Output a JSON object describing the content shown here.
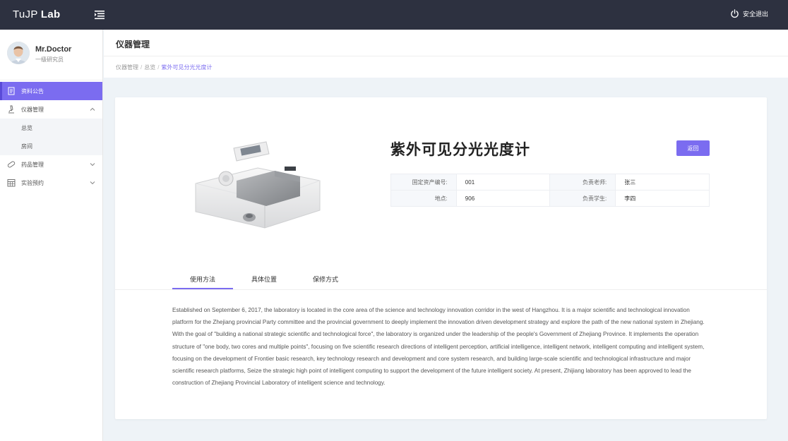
{
  "topbar": {
    "brand_prefix": "TuJP",
    "brand_suffix": "Lab",
    "logout_label": "安全退出"
  },
  "user": {
    "name": "Mr.Doctor",
    "role": "一级研究员"
  },
  "sidebar": {
    "items": [
      {
        "label": "资料公告",
        "icon": "document-icon"
      },
      {
        "label": "仪器管理",
        "icon": "microscope-icon",
        "expanded": true
      },
      {
        "label": "总览"
      },
      {
        "label": "房间"
      },
      {
        "label": "药品管理",
        "icon": "pill-icon"
      },
      {
        "label": "实验预约",
        "icon": "calendar-icon"
      }
    ]
  },
  "page": {
    "title": "仪器管理",
    "breadcrumb": [
      "仪器管理",
      "总览",
      "紫外可见分光光度计"
    ]
  },
  "instrument": {
    "name": "紫外可见分光光度计",
    "back_label": "返回",
    "fields": {
      "asset_no_label": "固定资产编号:",
      "asset_no": "001",
      "teacher_label": "负责老师:",
      "teacher": "张三",
      "location_label": "地点:",
      "location": "906",
      "student_label": "负责学生:",
      "student": "李四"
    }
  },
  "tabs": {
    "items": [
      "使用方法",
      "具体位置",
      "保修方式"
    ],
    "active": "使用方法"
  },
  "description": "Established on September 6, 2017, the laboratory is located in the core area of the science and technology innovation corridor in the west of Hangzhou. It is a major scientific and technological innovation platform for the Zhejiang provincial Party committee and the provincial government to deeply implement the innovation driven development strategy and explore the path of the new national system in Zhejiang. With the goal of \"building a national strategic scientific and technological force\", the laboratory is organized under the leadership of the people's Government of Zhejiang Province. It implements the operation structure of \"one body, two cores and multiple points\", focusing on five scientific research directions of intelligent perception, artificial intelligence, intelligent network, intelligent computing and intelligent system, focusing on the development of Frontier basic research, key technology research and development and core system research, and building large-scale scientific and technological infrastructure and major scientific research platforms, Seize the strategic high point of intelligent computing to support the development of the future intelligent society. At present, Zhijiang laboratory has been approved to lead the construction of Zhejiang Provincial Laboratory of intelligent science and technology.",
  "colors": {
    "topbar": "#2d3140",
    "accent": "#7b6cf0",
    "page_bg": "#eef3f7"
  }
}
